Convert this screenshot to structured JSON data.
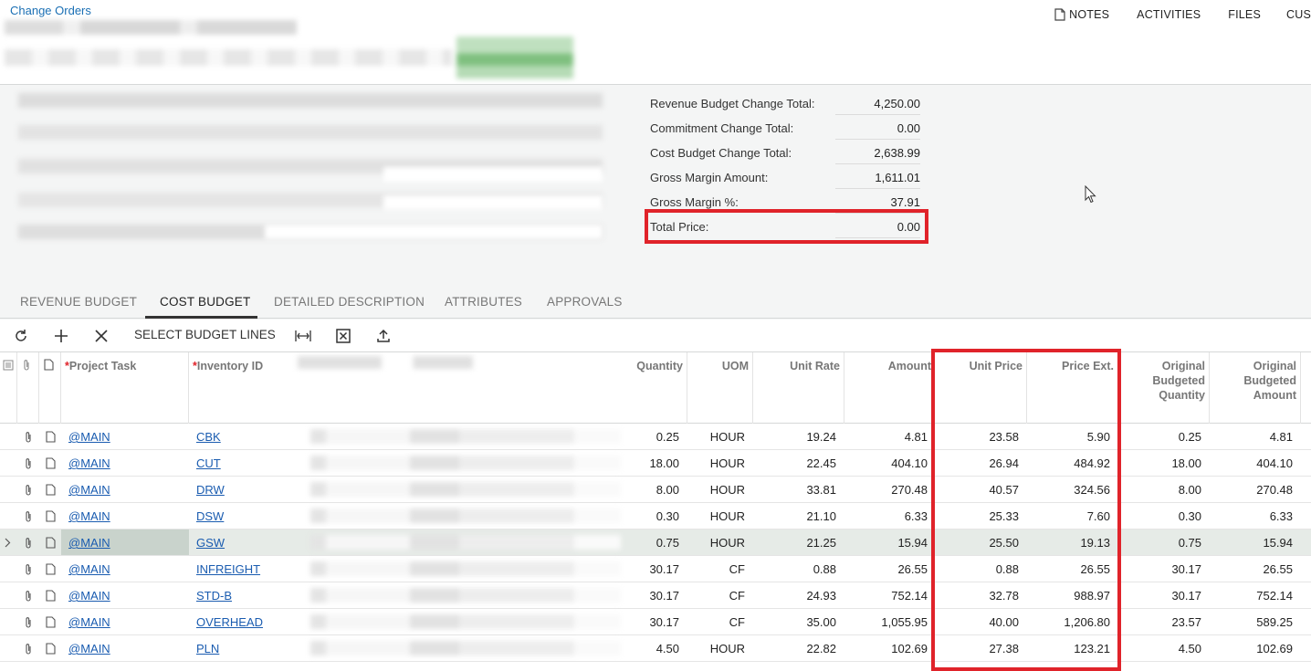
{
  "breadcrumb": "Change Orders",
  "topbar": {
    "notes": "NOTES",
    "activities": "ACTIVITIES",
    "files": "FILES",
    "cus": "CUS"
  },
  "summary": [
    {
      "label": "Revenue Budget Change Total:",
      "value": "4,250.00"
    },
    {
      "label": "Commitment Change Total:",
      "value": "0.00"
    },
    {
      "label": "Cost Budget Change Total:",
      "value": "2,638.99"
    },
    {
      "label": "Gross Margin Amount:",
      "value": "1,611.01"
    },
    {
      "label": "Gross Margin %:",
      "value": "37.91"
    },
    {
      "label": "Total Price:",
      "value": "0.00"
    }
  ],
  "tabs": [
    "REVENUE BUDGET",
    "COST BUDGET",
    "DETAILED DESCRIPTION",
    "ATTRIBUTES",
    "APPROVALS"
  ],
  "active_tab": "COST BUDGET",
  "toolbar": {
    "select_budget_lines": "SELECT BUDGET LINES"
  },
  "columns": {
    "project_task": "Project Task",
    "inventory_id": "Inventory ID",
    "quantity": "Quantity",
    "uom": "UOM",
    "unit_rate": "Unit Rate",
    "amount": "Amount",
    "unit_price": "Unit Price",
    "price_ext": "Price Ext.",
    "orig_qty_1": "Original",
    "orig_qty_2": "Budgeted",
    "orig_qty_3": "Quantity",
    "orig_amt_1": "Original",
    "orig_amt_2": "Budgeted",
    "orig_amt_3": "Amount"
  },
  "rows": [
    {
      "task": "@MAIN",
      "inv": "CBK",
      "qty": "0.25",
      "uom": "HOUR",
      "rate": "19.24",
      "amount": "4.81",
      "unit_price": "23.58",
      "price_ext": "5.90",
      "orig_qty": "0.25",
      "orig_amt": "4.81"
    },
    {
      "task": "@MAIN",
      "inv": "CUT",
      "qty": "18.00",
      "uom": "HOUR",
      "rate": "22.45",
      "amount": "404.10",
      "unit_price": "26.94",
      "price_ext": "484.92",
      "orig_qty": "18.00",
      "orig_amt": "404.10"
    },
    {
      "task": "@MAIN",
      "inv": "DRW",
      "qty": "8.00",
      "uom": "HOUR",
      "rate": "33.81",
      "amount": "270.48",
      "unit_price": "40.57",
      "price_ext": "324.56",
      "orig_qty": "8.00",
      "orig_amt": "270.48"
    },
    {
      "task": "@MAIN",
      "inv": "DSW",
      "qty": "0.30",
      "uom": "HOUR",
      "rate": "21.10",
      "amount": "6.33",
      "unit_price": "25.33",
      "price_ext": "7.60",
      "orig_qty": "0.30",
      "orig_amt": "6.33"
    },
    {
      "task": "@MAIN",
      "inv": "GSW",
      "qty": "0.75",
      "uom": "HOUR",
      "rate": "21.25",
      "amount": "15.94",
      "unit_price": "25.50",
      "price_ext": "19.13",
      "orig_qty": "0.75",
      "orig_amt": "15.94"
    },
    {
      "task": "@MAIN",
      "inv": "INFREIGHT",
      "qty": "30.17",
      "uom": "CF",
      "rate": "0.88",
      "amount": "26.55",
      "unit_price": "0.88",
      "price_ext": "26.55",
      "orig_qty": "30.17",
      "orig_amt": "26.55"
    },
    {
      "task": "@MAIN",
      "inv": "STD-B",
      "qty": "30.17",
      "uom": "CF",
      "rate": "24.93",
      "amount": "752.14",
      "unit_price": "32.78",
      "price_ext": "988.97",
      "orig_qty": "30.17",
      "orig_amt": "752.14"
    },
    {
      "task": "@MAIN",
      "inv": "OVERHEAD",
      "qty": "30.17",
      "uom": "CF",
      "rate": "35.00",
      "amount": "1,055.95",
      "unit_price": "40.00",
      "price_ext": "1,206.80",
      "orig_qty": "23.57",
      "orig_amt": "589.25"
    },
    {
      "task": "@MAIN",
      "inv": "PLN",
      "qty": "4.50",
      "uom": "HOUR",
      "rate": "22.82",
      "amount": "102.69",
      "unit_price": "27.38",
      "price_ext": "123.21",
      "orig_qty": "4.50",
      "orig_amt": "102.69"
    }
  ],
  "selected_row": 4,
  "colors": {
    "link": "#1a5cb0",
    "highlight": "#e0232a",
    "panel": "#f4f5f5"
  }
}
